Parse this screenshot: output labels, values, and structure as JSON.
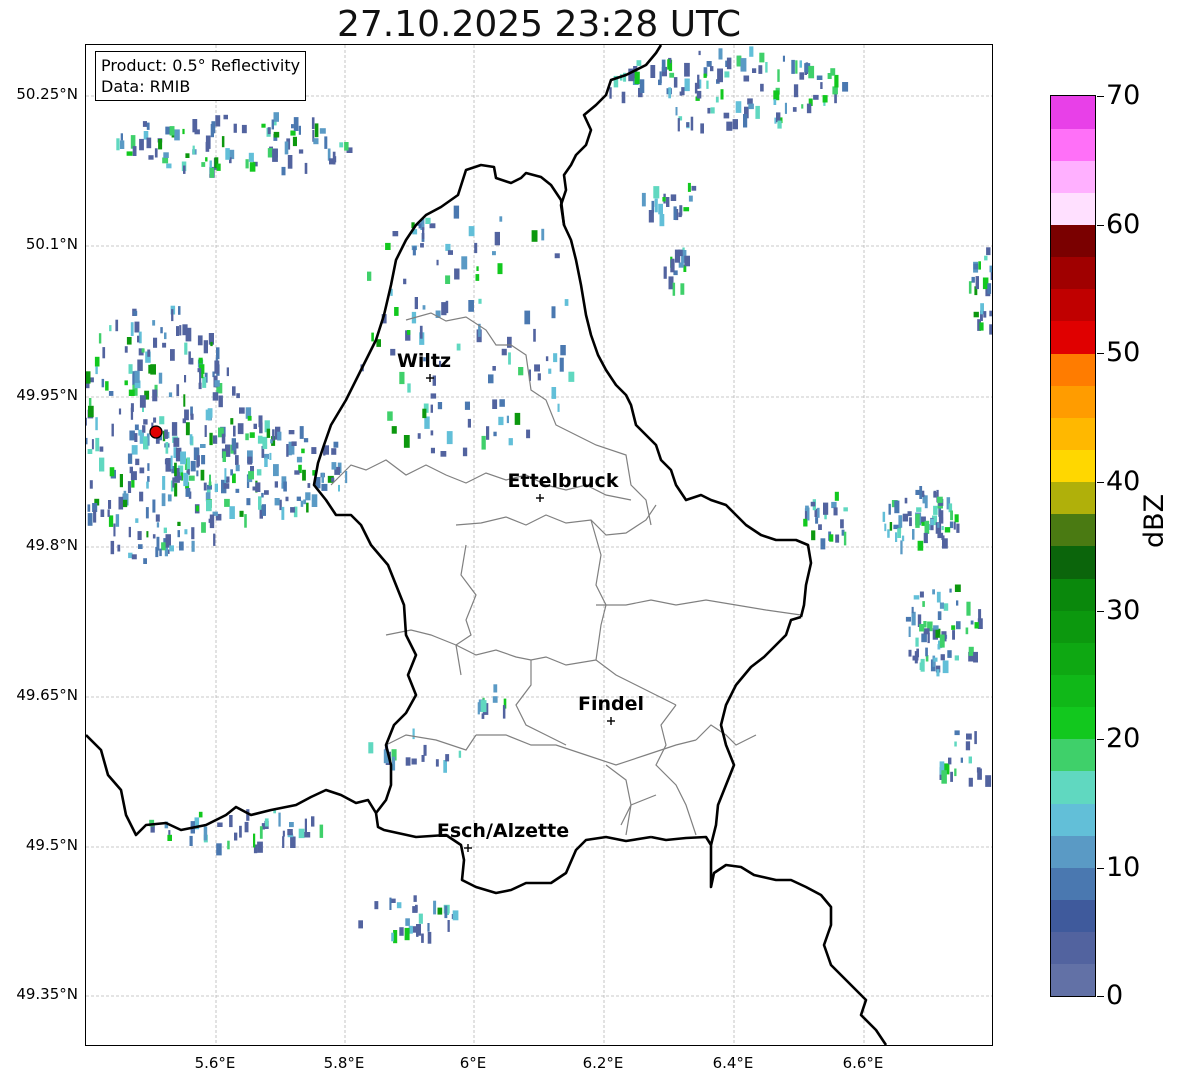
{
  "title": "27.10.2025 23:28 UTC",
  "info": {
    "product": "Product: 0.5° Reflectivity",
    "data": "Data: RMIB"
  },
  "axes": {
    "x_labels": [
      "5.6°E",
      "5.8°E",
      "6°E",
      "6.2°E",
      "6.4°E",
      "6.6°E"
    ],
    "y_labels": [
      "50.25°N",
      "50.1°N",
      "49.95°N",
      "49.8°N",
      "49.65°N",
      "49.5°N",
      "49.35°N"
    ]
  },
  "colorbar": {
    "unit": "dBZ",
    "tick_labels": [
      "70",
      "60",
      "50",
      "40",
      "30",
      "20",
      "10",
      "0"
    ],
    "colors": [
      "#6271a6",
      "#52639f",
      "#3f5a9c",
      "#4a78b0",
      "#5a9ac5",
      "#62bfd8",
      "#60d8c0",
      "#3fd06a",
      "#12c81e",
      "#10b818",
      "#0ea812",
      "#0c980e",
      "#0a880c",
      "#0b650b",
      "#4a7a12",
      "#b0b00a",
      "#ffd700",
      "#ffb800",
      "#ff9c00",
      "#ff7c00",
      "#e00000",
      "#c00000",
      "#a00000",
      "#7a0000",
      "#ffe0ff",
      "#ffb0ff",
      "#ff70f8",
      "#e840e8"
    ]
  },
  "cities": [
    {
      "name": "Wiltz"
    },
    {
      "name": "Ettelbruck"
    },
    {
      "name": "Findel"
    },
    {
      "name": "Esch/Alzette"
    }
  ],
  "radar_marker": {
    "color": "#e00000"
  },
  "map_colors": {
    "border": "#000000",
    "cantons": "#808080",
    "grid": "#b8b8b8"
  }
}
